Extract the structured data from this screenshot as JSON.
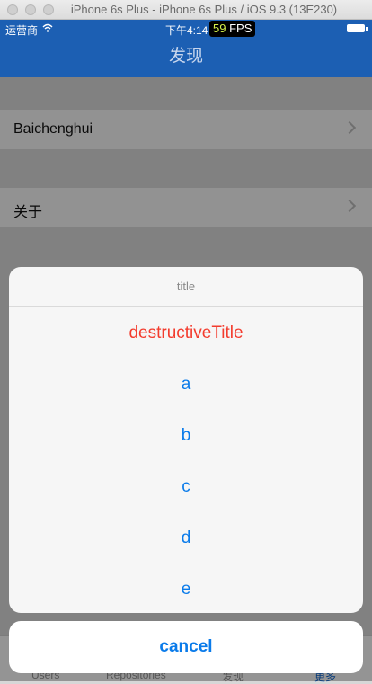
{
  "window": {
    "title": "iPhone 6s Plus - iPhone 6s Plus / iOS 9.3 (13E230)"
  },
  "statusbar": {
    "carrier": "运营商",
    "time": "下午4:14",
    "fps_value": "59",
    "fps_label": "FPS"
  },
  "navbar": {
    "title": "发现"
  },
  "list": {
    "rows": [
      {
        "label": "Baichenghui"
      },
      {
        "label": "关于"
      }
    ]
  },
  "tabbar": {
    "tabs": [
      {
        "label": "Users"
      },
      {
        "label": "Repositories"
      },
      {
        "label": "发现"
      },
      {
        "label": "更多"
      }
    ]
  },
  "action_sheet": {
    "title": "title",
    "destructive": "destructiveTitle",
    "buttons": [
      "a",
      "b",
      "c",
      "d",
      "e"
    ],
    "cancel": "cancel"
  },
  "colors": {
    "accent": "#0a7bea",
    "destructive": "#f33c2e",
    "navbar": "#1c5fb3"
  }
}
